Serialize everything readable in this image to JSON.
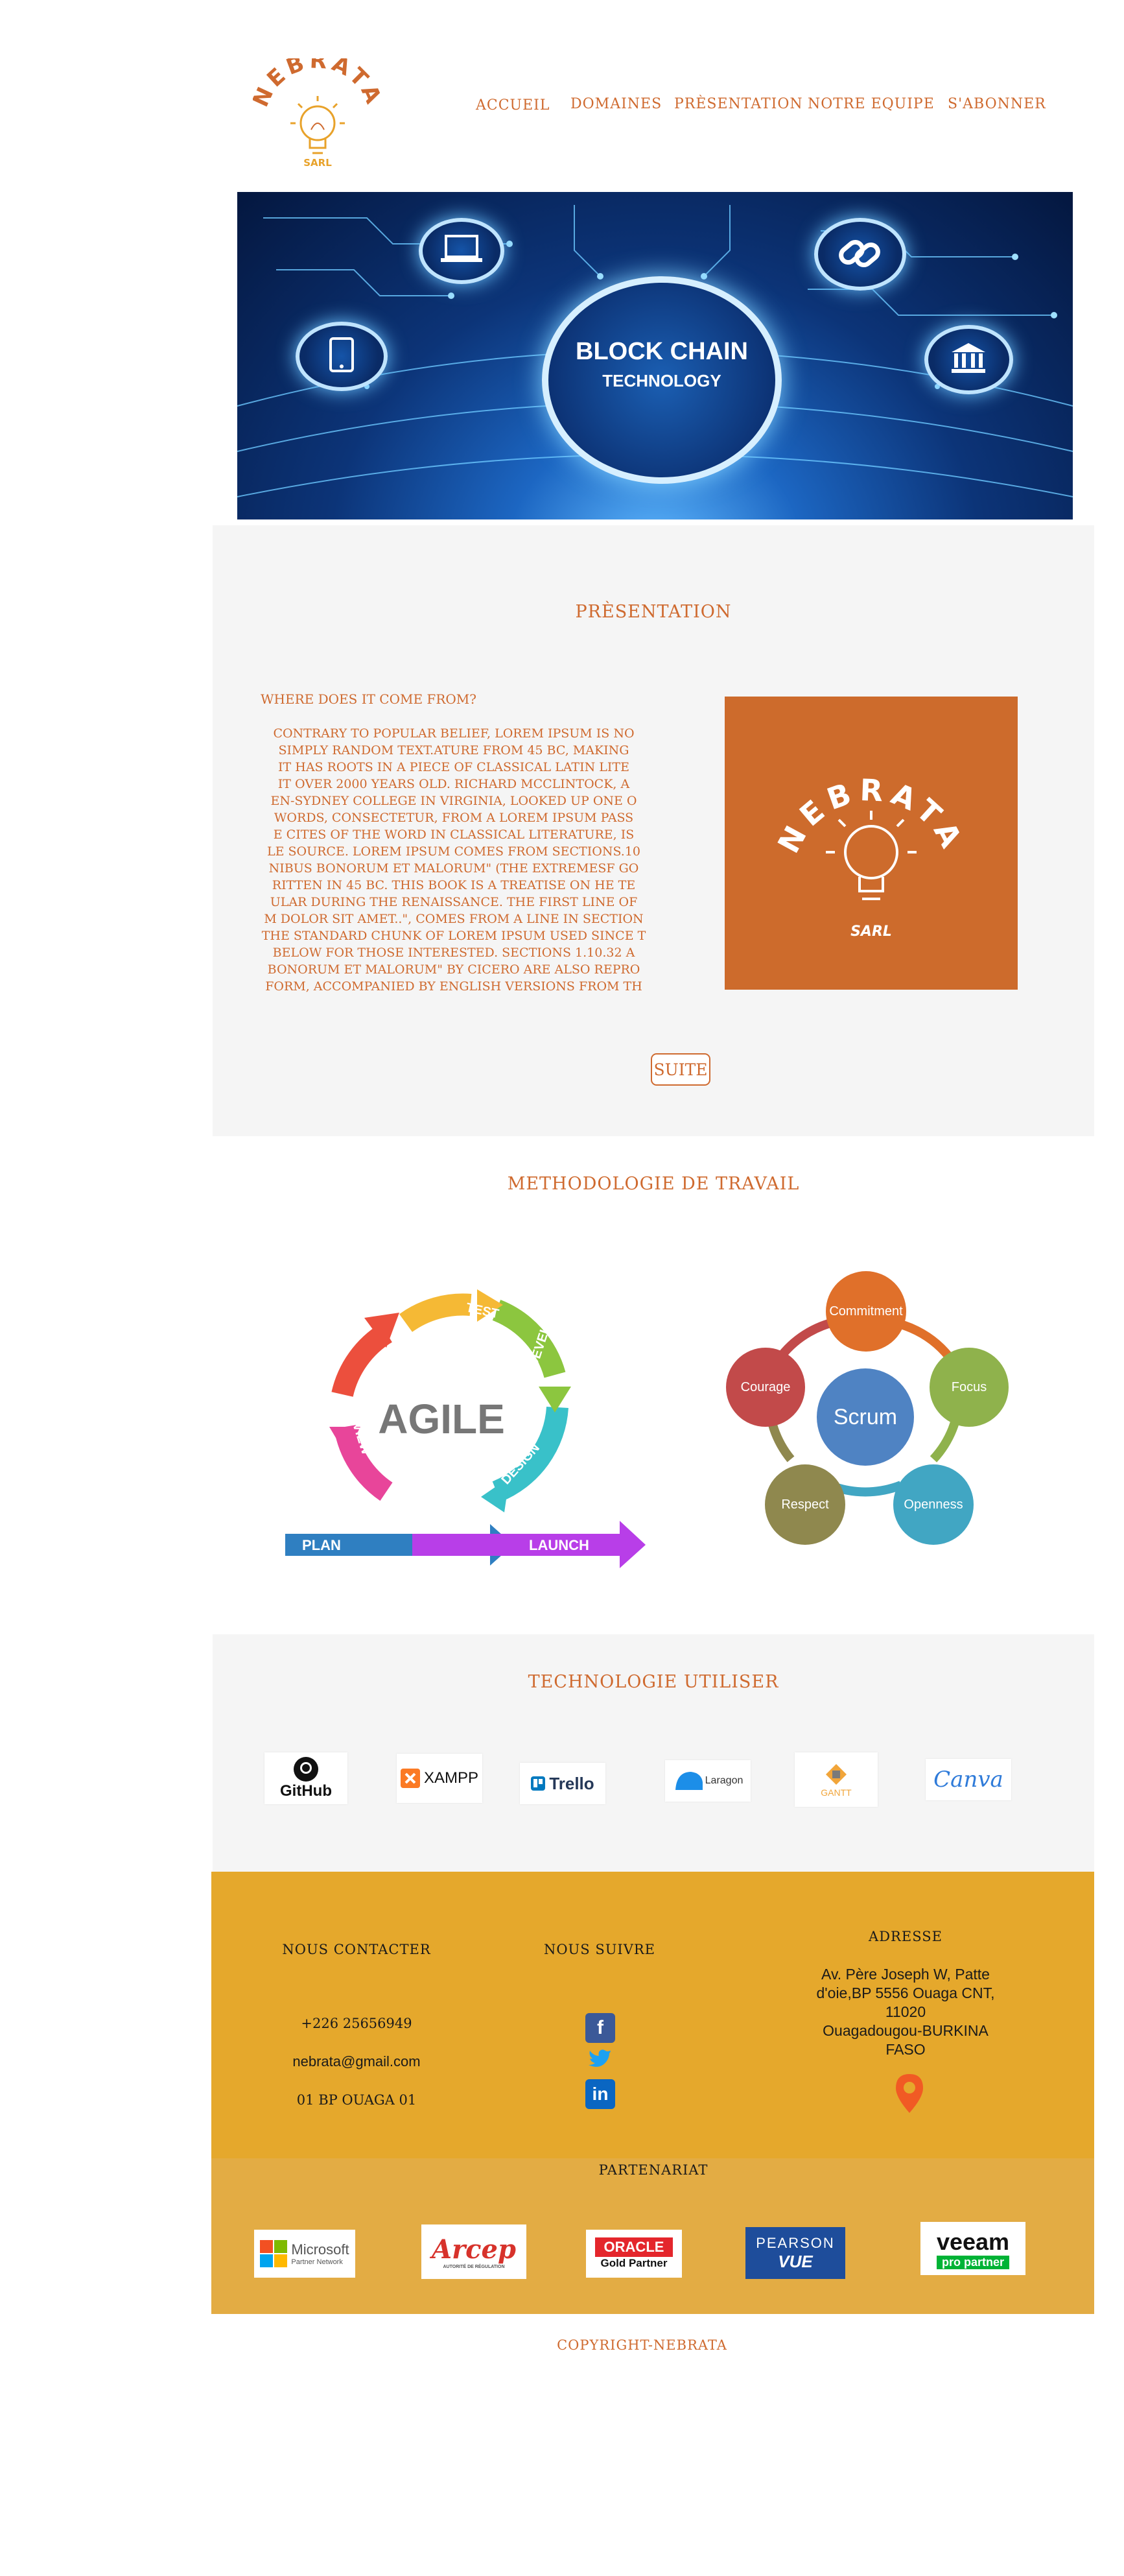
{
  "brand": {
    "name": "NEBRATA",
    "suffix": "SARL",
    "color": "#cf6a2f",
    "accent": "#e8a22a"
  },
  "nav": {
    "items": [
      "ACCUEIL",
      "DOMAINES",
      "PRÈSENTATION",
      "NOTRE EQUIPE",
      "S'ABONNER"
    ]
  },
  "banner": {
    "title": "BLOCK CHAIN",
    "subtitle": "TECHNOLOGY",
    "icons": [
      "laptop-icon",
      "link-icon",
      "tablet-icon",
      "bank-icon"
    ]
  },
  "presentation": {
    "title": "PRÈSENTATION",
    "heading": "WHERE DOES IT COME FROM?",
    "lines": [
      "CONTRARY TO POPULAR BELIEF, LOREM IPSUM IS NO",
      "SIMPLY RANDOM TEXT.ATURE FROM 45 BC, MAKING",
      "IT HAS ROOTS IN A PIECE OF CLASSICAL LATIN LITE",
      "IT OVER 2000 YEARS OLD. RICHARD MCCLINTOCK, A",
      "EN-SYDNEY COLLEGE IN VIRGINIA, LOOKED UP ONE O",
      "WORDS, CONSECTETUR, FROM A LOREM IPSUM PASS",
      "E CITES OF THE WORD IN CLASSICAL LITERATURE, IS",
      "LE SOURCE. LOREM IPSUM COMES FROM SECTIONS.10",
      "NIBUS BONORUM ET MALORUM\" (THE EXTREMESF GO",
      "RITTEN IN 45 BC. THIS BOOK IS A TREATISE ON HE TE",
      "ULAR DURING THE RENAISSANCE. THE FIRST LINE OF",
      "M DOLOR SIT AMET..\", COMES FROM A LINE IN SECTION",
      "THE STANDARD CHUNK OF LOREM IPSUM USED SINCE T",
      "BELOW FOR THOSE INTERESTED. SECTIONS 1.10.32 A",
      "BONORUM ET MALORUM\" BY CICERO ARE ALSO REPRO",
      "FORM, ACCOMPANIED BY ENGLISH VERSIONS FROM TH"
    ],
    "button": "SUITE"
  },
  "methodology": {
    "title": "METHODOLOGIE DE TRAVAIL",
    "agile": {
      "center": "AGILE",
      "stages": [
        "TEST",
        "DEVELOP",
        "DESIGN",
        "LAUNCH",
        "PLAN",
        "REVIEW",
        "DEPLOY"
      ]
    },
    "scrum": {
      "center": "Scrum",
      "values": [
        "Commitment",
        "Focus",
        "Openness",
        "Respect",
        "Courage"
      ]
    }
  },
  "technologies": {
    "title": "TECHNOLOGIE UTILISER",
    "items": [
      "GitHub",
      "XAMPP",
      "Trello",
      "Laragon",
      "GANTT",
      "Canva"
    ]
  },
  "contact": {
    "title": "NOUS CONTACTER",
    "phone": "+226 25656949",
    "email": "nebrata@gmail.com",
    "po_box": "01 BP OUAGA 01"
  },
  "follow": {
    "title": "NOUS SUIVRE",
    "networks": [
      "facebook-icon",
      "twitter-icon",
      "linkedin-icon"
    ]
  },
  "address": {
    "title": "ADRESSE",
    "lines": [
      "Av. Père Joseph W, Patte",
      "d'oie,BP 5556 Ouaga CNT,",
      "11020",
      "Ouagadougou-BURKINA",
      "FASO"
    ]
  },
  "partners": {
    "title": "PARTENARIAT",
    "items": [
      {
        "name": "Microsoft",
        "sub": "Partner Network"
      },
      {
        "name": "Arcep",
        "sub": "AUTORITÉ DE RÉGULATION"
      },
      {
        "name": "ORACLE",
        "sub": "Gold Partner"
      },
      {
        "name": "PEARSON",
        "sub": "VUE"
      },
      {
        "name": "veeam",
        "sub": "pro partner"
      }
    ]
  },
  "footer": {
    "copyright": "COPYRIGHT-NEBRATA"
  }
}
